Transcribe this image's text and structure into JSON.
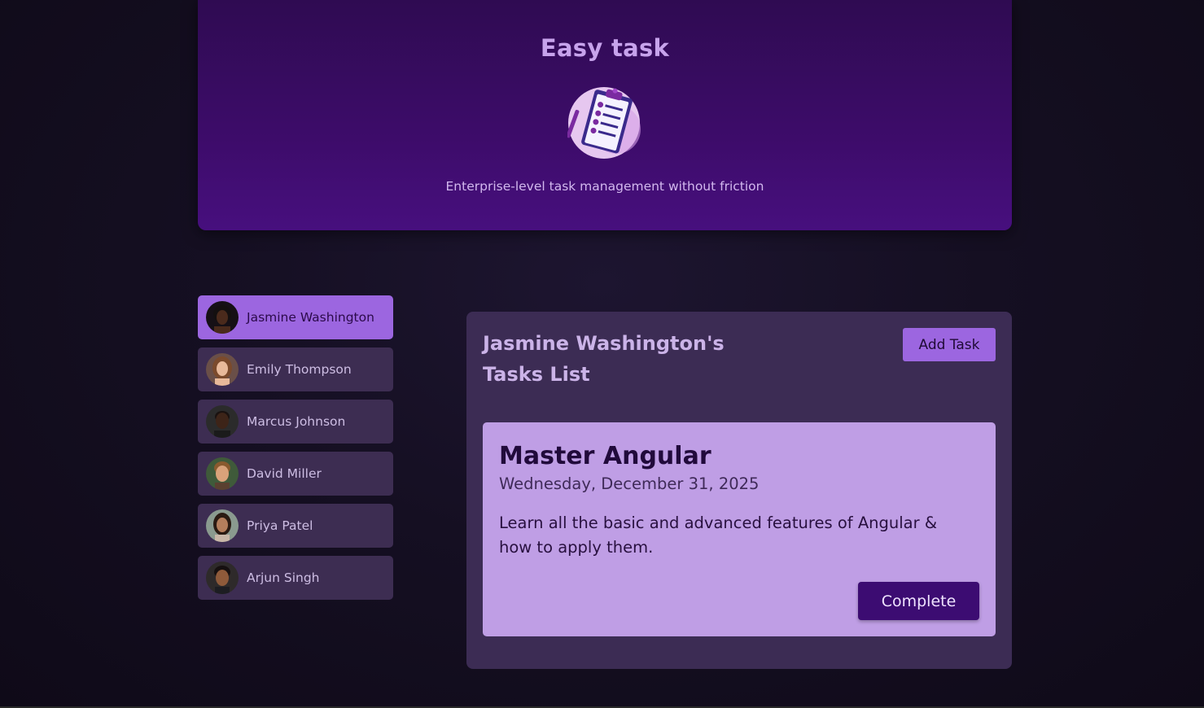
{
  "header": {
    "title": "Easy task",
    "logo_icon": "clipboard-checklist-icon",
    "tagline": "Enterprise-level task management without friction"
  },
  "users": [
    {
      "name": "Jasmine Washington",
      "selected": true,
      "skin": "#4a2a1c",
      "hair": "#141010"
    },
    {
      "name": "Emily Thompson",
      "selected": false,
      "skin": "#e8b99a",
      "hair": "#7b4a2c"
    },
    {
      "name": "Marcus Johnson",
      "selected": false,
      "skin": "#3d2418",
      "hair": "#1a1210"
    },
    {
      "name": "David Miller",
      "selected": false,
      "skin": "#d9a27a",
      "hair": "#8a5a2e"
    },
    {
      "name": "Priya Patel",
      "selected": false,
      "skin": "#b47e5c",
      "hair": "#2a1a12"
    },
    {
      "name": "Arjun Singh",
      "selected": false,
      "skin": "#8e5a3a",
      "hair": "#161010"
    }
  ],
  "tasks": {
    "title_line1": "Jasmine Washington's",
    "title_line2": "Tasks List",
    "add_button_label": "Add Task",
    "items": [
      {
        "title": "Master Angular",
        "date": "Wednesday, December 31, 2025",
        "description": "Learn all the basic and advanced features of Angular & how to apply them.",
        "complete_label": "Complete"
      }
    ]
  },
  "colors": {
    "accent": "#9c66e0",
    "card": "#bf9ee5",
    "primary_button": "#3c0c72"
  }
}
